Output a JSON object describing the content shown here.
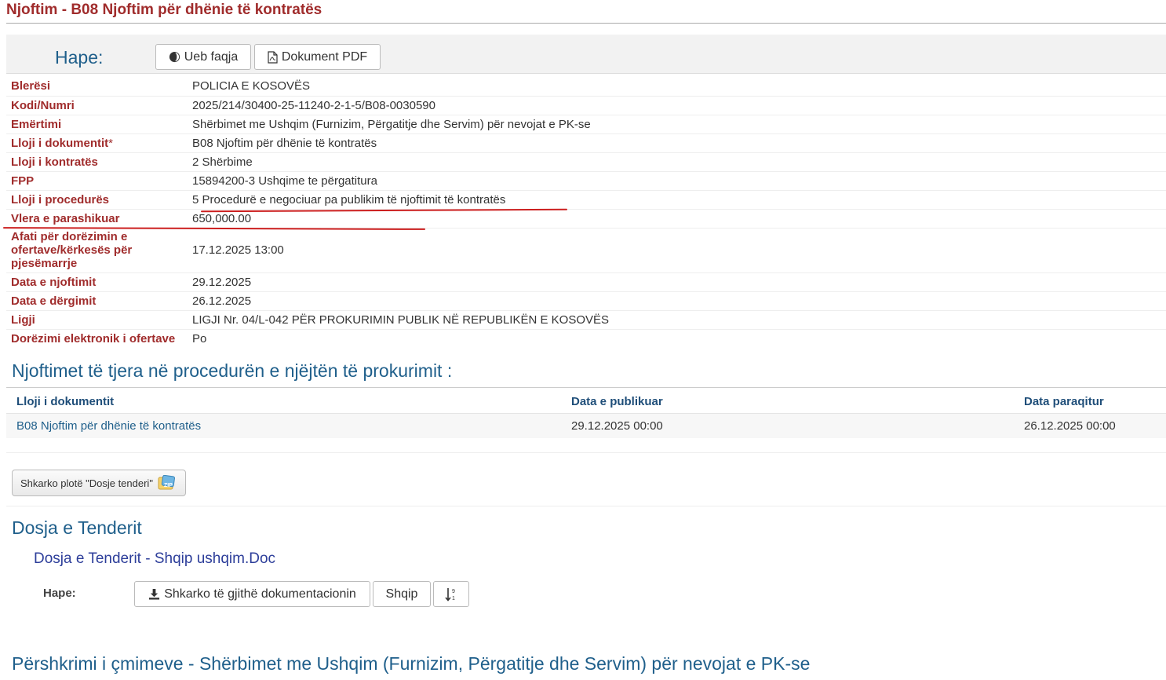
{
  "header": {
    "title": "Njoftim - B08 Njoftim për dhënie të kontratës"
  },
  "open_bar": {
    "label": "Hape:",
    "web_button": "Ueb faqja",
    "pdf_button": "Dokument PDF"
  },
  "details": [
    {
      "label": "Blerësi",
      "value": "POLICIA E KOSOVËS"
    },
    {
      "label": "Kodi/Numri",
      "value": "2025/214/30400-25-11240-2-1-5/B08-0030590"
    },
    {
      "label": "Emërtimi",
      "value": "Shërbimet me Ushqim (Furnizim, Përgatitje dhe Servim) për nevojat e PK-se"
    },
    {
      "label": "Lloji i dokumentit",
      "required_mark": "*",
      "value": "B08 Njoftim për dhënie të kontratës"
    },
    {
      "label": "Lloji i kontratës",
      "value": "2 Shërbime"
    },
    {
      "label": "FPP",
      "value": "15894200-3 Ushqime te përgatitura"
    },
    {
      "label": "Lloji i procedurës",
      "value": "5 Procedurë e negociuar pa publikim të njoftimit të kontratës"
    },
    {
      "label": "Vlera e parashikuar",
      "value": "650,000.00"
    },
    {
      "label": "Afati për dorëzimin e ofertave/kërkesës për pjesëmarrje",
      "value": "17.12.2025 13:00"
    },
    {
      "label": "Data e njoftimit",
      "value": "29.12.2025"
    },
    {
      "label": "Data e dërgimit",
      "value": "26.12.2025"
    },
    {
      "label": "Ligji",
      "value": "LIGJI Nr. 04/L-042 PËR PROKURIMIN PUBLIK NË REPUBLIKËN E KOSOVËS"
    },
    {
      "label": "Dorëzimi elektronik i ofertave",
      "value": "Po"
    }
  ],
  "other_notices": {
    "title": "Njoftimet të tjera në procedurën e njëjtën të prokurimit :",
    "columns": [
      "Lloji i dokumentit",
      "Data e publikuar",
      "Data paraqitur"
    ],
    "rows": [
      [
        "B08 Njoftim për dhënie të kontratës",
        "29.12.2025 00:00",
        "26.12.2025 00:00"
      ]
    ]
  },
  "download_zip": {
    "label": "Shkarko plotë \"Dosje tenderi\"",
    "icon_text": "ZIP"
  },
  "tender_file": {
    "title": "Dosja e Tenderit",
    "document_link": "Dosja e Tenderit - Shqip ushqim.Doc",
    "open_label": "Hape:",
    "download_all": "Shkarko të gjithë dokumentacionin",
    "language": "Shqip",
    "sort_icon": "sort-numeric-icon"
  },
  "price_description": {
    "title": "Përshkrimi i çmimeve - Shërbimet me Ushqim (Furnizim, Përgatitje dhe Servim) për nevojat e PK-se"
  },
  "colors": {
    "label_red": "#a02c2c",
    "heading_blue": "#1f5f8b",
    "annotation_red": "#cc1f1f"
  }
}
